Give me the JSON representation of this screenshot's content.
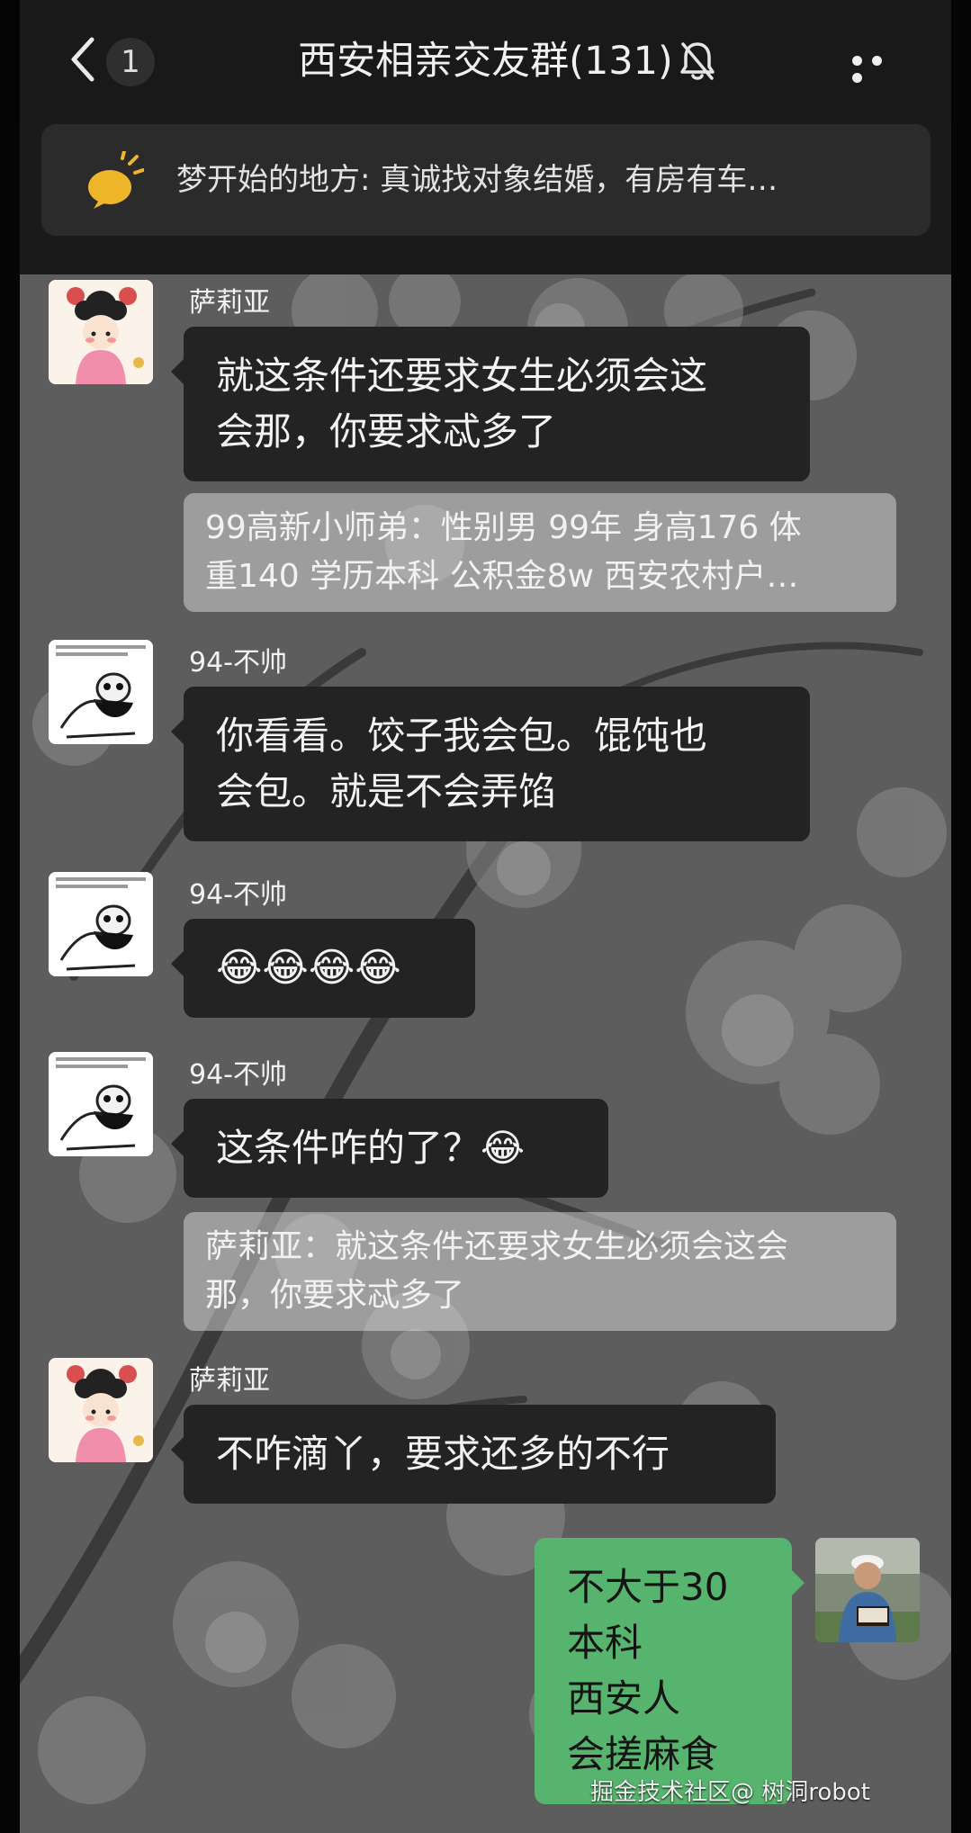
{
  "header": {
    "unread_count": "1",
    "title": "西安相亲交友群(131)"
  },
  "announcement": {
    "text": "梦开始的地方: 真诚找对象结婚，有房有车…"
  },
  "messages": [
    {
      "sender": "萨莉亚",
      "lines": [
        "就这条件还要求女生必须会这",
        "会那，你要求忒多了"
      ],
      "quote": [
        "99高新小师弟：性别男 99年 身高176 体",
        "重140 学历本科 公积金8w 西安农村户…"
      ]
    },
    {
      "sender": "94-不帅",
      "lines": [
        "你看看。饺子我会包。馄饨也",
        "会包。就是不会弄馅"
      ]
    },
    {
      "sender": "94-不帅",
      "lines": [
        "😂😂😂😂"
      ]
    },
    {
      "sender": "94-不帅",
      "lines": [
        "这条件咋的了？😂"
      ],
      "quote": [
        "萨莉亚：就这条件还要求女生必须会这会",
        "那，你要求忒多了"
      ]
    },
    {
      "sender": "萨莉亚",
      "lines": [
        "不咋滴丫，要求还多的不行"
      ]
    },
    {
      "sender": "me",
      "lines": [
        "不大于30",
        "本科",
        "西安人",
        "会搓麻食"
      ]
    }
  ],
  "watermark": "掘金技术社区@ 树洞robot",
  "icons": {
    "back": "chevron-left-icon",
    "mute": "bell-off-icon",
    "more": "more-dots-icon",
    "announcement": "megaphone-icon"
  },
  "colors": {
    "my_bubble": "#56b46e",
    "other_bubble": "#232323",
    "header_bg": "#191919"
  }
}
